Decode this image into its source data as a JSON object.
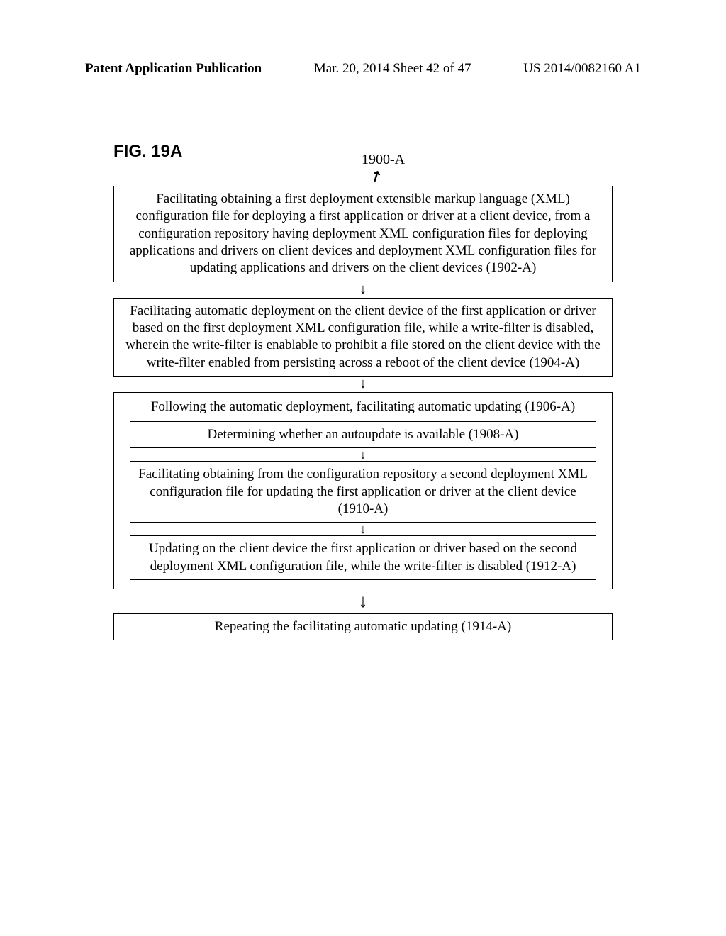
{
  "header": {
    "left": "Patent Application Publication",
    "center": "Mar. 20, 2014  Sheet 42 of 47",
    "right": "US 2014/0082160 A1"
  },
  "figure_label": "FIG. 19A",
  "reference_number": "1900-A",
  "steps": {
    "step1": "Facilitating obtaining a first deployment extensible markup language (XML) configuration file for deploying a first application or driver at a client device, from a configuration repository having deployment XML configuration files for deploying applications and drivers on client devices and deployment XML configuration files for updating applications and drivers on the client devices (1902-A)",
    "step2": "Facilitating automatic deployment on the client device of the first application or driver based on the first deployment XML configuration file, while a write-filter is disabled, wherein the write-filter is enablable to prohibit a file stored on the client device with the write-filter enabled from persisting across a reboot of the client device (1904-A)",
    "step3_title": "Following the automatic deployment, facilitating automatic updating (1906-A)",
    "step3a": "Determining whether an autoupdate is available (1908-A)",
    "step3b": "Facilitating obtaining from the configuration repository a second deployment XML configuration file for updating the first application or driver at the client device (1910-A)",
    "step3c": "Updating on the client device the first application or driver based on the second deployment XML configuration file, while the write-filter is disabled (1912-A)",
    "step4": "Repeating the facilitating automatic updating (1914-A)"
  }
}
